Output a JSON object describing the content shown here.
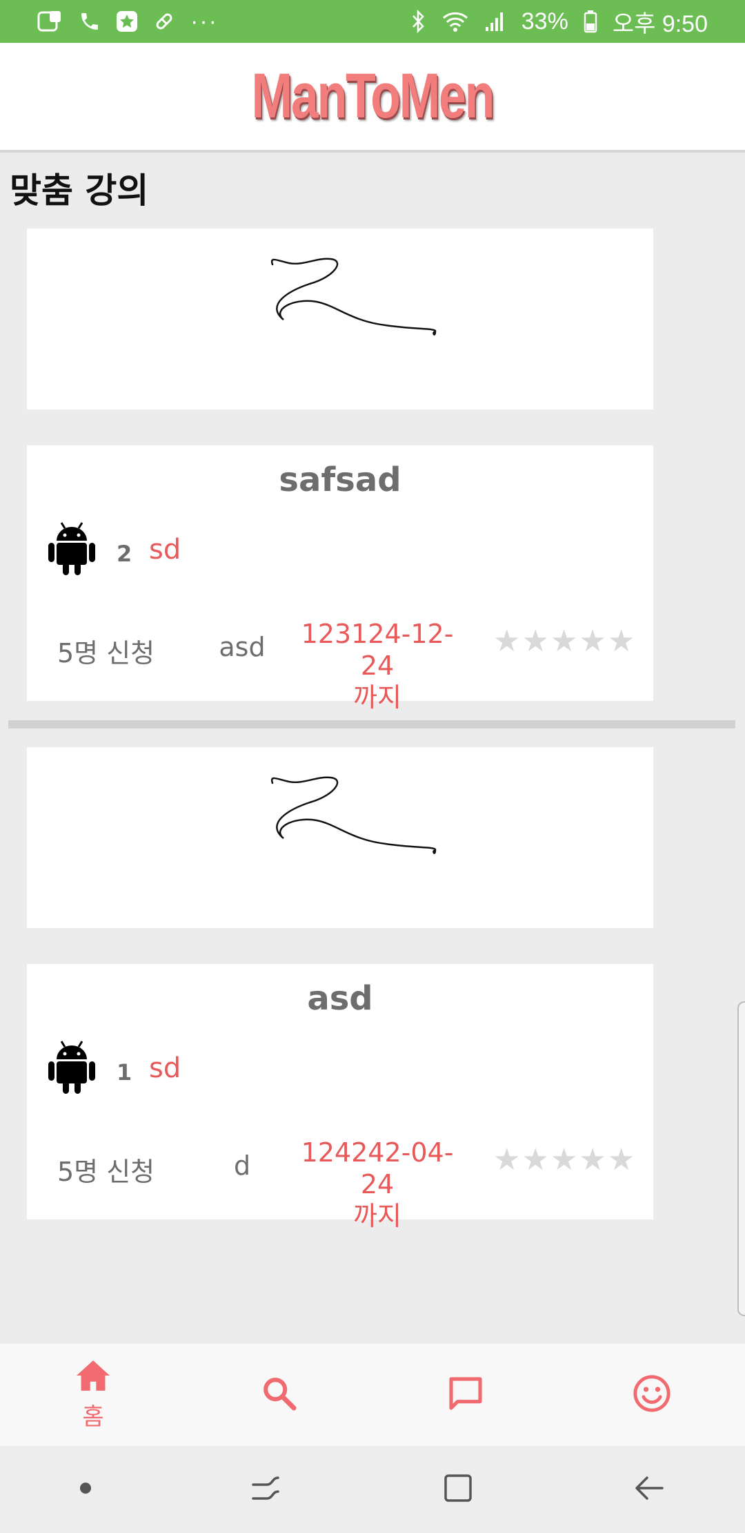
{
  "status_bar": {
    "battery": "33%",
    "time": "오후 9:50",
    "more": "···"
  },
  "app": {
    "title": "ManToMen"
  },
  "section": {
    "title": "맞춤 강의"
  },
  "courses": [
    {
      "title": "safsad",
      "count": "2",
      "category": "sd",
      "applicants": "5명 신청",
      "teacher": "asd",
      "deadline_date": "123124-12-24",
      "deadline_suffix": "까지",
      "rating": 0,
      "rating_max": 5
    },
    {
      "title": "asd",
      "count": "1",
      "category": "sd",
      "applicants": "5명 신청",
      "teacher": "d",
      "deadline_date": "124242-04-24",
      "deadline_suffix": "까지",
      "rating": 0,
      "rating_max": 5
    }
  ],
  "bottom_nav": {
    "home_label": "홈",
    "active": "home",
    "accent": "#f06a6f"
  },
  "colors": {
    "status_bar": "#6cbd53",
    "accent_red": "#e8595a",
    "logo": "#f27d7d"
  }
}
